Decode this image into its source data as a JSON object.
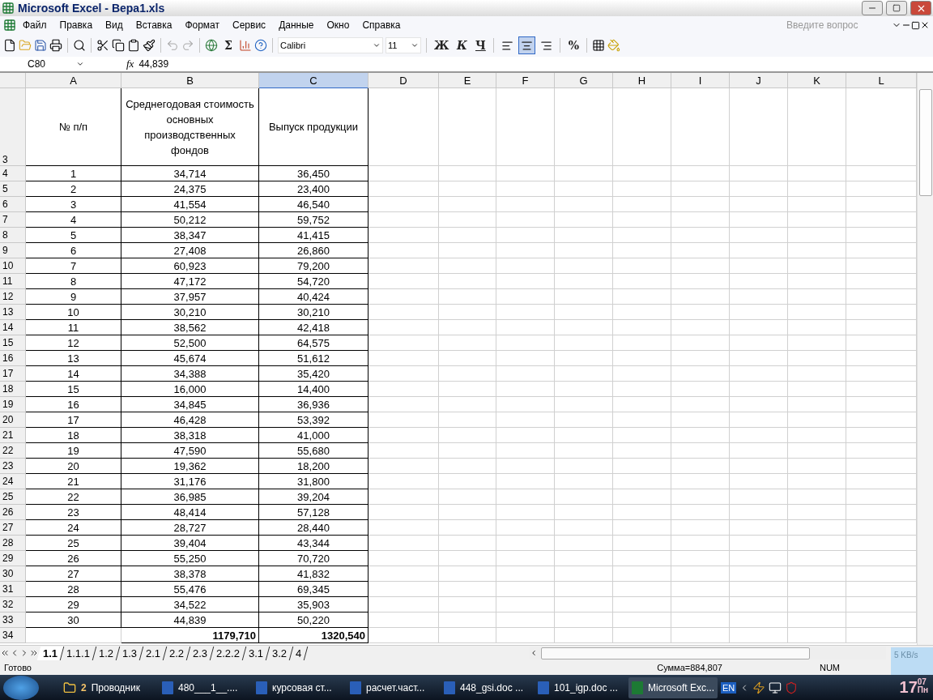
{
  "window": {
    "title": "Microsoft Excel - Вера1.xls"
  },
  "menu": {
    "items": [
      "Файл",
      "Правка",
      "Вид",
      "Вставка",
      "Формат",
      "Сервис",
      "Данные",
      "Окно",
      "Справка"
    ],
    "help_placeholder": "Введите вопрос"
  },
  "toolbar": {
    "sum": "Σ",
    "font": "Calibri",
    "size": "11",
    "format_buttons": [
      {
        "label": "Ж",
        "kind": "bold",
        "selected": false
      },
      {
        "label": "К",
        "kind": "italic",
        "selected": false
      },
      {
        "label": "Ч",
        "kind": "underline",
        "selected": false
      }
    ],
    "align_buttons": [
      {
        "kind": "left",
        "selected": false
      },
      {
        "kind": "center",
        "selected": true
      },
      {
        "kind": "right",
        "selected": false
      }
    ],
    "percent": "%"
  },
  "formula_bar": {
    "name_box": "C80",
    "fx": "fx",
    "value": "44,839"
  },
  "columns": [
    {
      "label": "A",
      "selected": false
    },
    {
      "label": "B",
      "selected": false
    },
    {
      "label": "C",
      "selected": true
    },
    {
      "label": "D",
      "selected": false
    },
    {
      "label": "E",
      "selected": false
    },
    {
      "label": "F",
      "selected": false
    },
    {
      "label": "G",
      "selected": false
    },
    {
      "label": "H",
      "selected": false
    },
    {
      "label": "I",
      "selected": false
    },
    {
      "label": "J",
      "selected": false
    },
    {
      "label": "K",
      "selected": false
    },
    {
      "label": "L",
      "selected": false
    }
  ],
  "header_row": {
    "number": "3",
    "cells": [
      "№ п/п",
      "Среднегодовая стоимость основных производственных фондов",
      "Выпуск продукции"
    ]
  },
  "rows": [
    {
      "number": "4",
      "cells": [
        "1",
        "34,714",
        "36,450"
      ]
    },
    {
      "number": "5",
      "cells": [
        "2",
        "24,375",
        "23,400"
      ]
    },
    {
      "number": "6",
      "cells": [
        "3",
        "41,554",
        "46,540"
      ]
    },
    {
      "number": "7",
      "cells": [
        "4",
        "50,212",
        "59,752"
      ]
    },
    {
      "number": "8",
      "cells": [
        "5",
        "38,347",
        "41,415"
      ]
    },
    {
      "number": "9",
      "cells": [
        "6",
        "27,408",
        "26,860"
      ]
    },
    {
      "number": "10",
      "cells": [
        "7",
        "60,923",
        "79,200"
      ]
    },
    {
      "number": "11",
      "cells": [
        "8",
        "47,172",
        "54,720"
      ]
    },
    {
      "number": "12",
      "cells": [
        "9",
        "37,957",
        "40,424"
      ]
    },
    {
      "number": "13",
      "cells": [
        "10",
        "30,210",
        "30,210"
      ]
    },
    {
      "number": "14",
      "cells": [
        "11",
        "38,562",
        "42,418"
      ]
    },
    {
      "number": "15",
      "cells": [
        "12",
        "52,500",
        "64,575"
      ]
    },
    {
      "number": "16",
      "cells": [
        "13",
        "45,674",
        "51,612"
      ]
    },
    {
      "number": "17",
      "cells": [
        "14",
        "34,388",
        "35,420"
      ]
    },
    {
      "number": "18",
      "cells": [
        "15",
        "16,000",
        "14,400"
      ]
    },
    {
      "number": "19",
      "cells": [
        "16",
        "34,845",
        "36,936"
      ]
    },
    {
      "number": "20",
      "cells": [
        "17",
        "46,428",
        "53,392"
      ]
    },
    {
      "number": "21",
      "cells": [
        "18",
        "38,318",
        "41,000"
      ]
    },
    {
      "number": "22",
      "cells": [
        "19",
        "47,590",
        "55,680"
      ]
    },
    {
      "number": "23",
      "cells": [
        "20",
        "19,362",
        "18,200"
      ]
    },
    {
      "number": "24",
      "cells": [
        "21",
        "31,176",
        "31,800"
      ]
    },
    {
      "number": "25",
      "cells": [
        "22",
        "36,985",
        "39,204"
      ]
    },
    {
      "number": "26",
      "cells": [
        "23",
        "48,414",
        "57,128"
      ]
    },
    {
      "number": "27",
      "cells": [
        "24",
        "28,727",
        "28,440"
      ]
    },
    {
      "number": "28",
      "cells": [
        "25",
        "39,404",
        "43,344"
      ]
    },
    {
      "number": "29",
      "cells": [
        "26",
        "55,250",
        "70,720"
      ]
    },
    {
      "number": "30",
      "cells": [
        "27",
        "38,378",
        "41,832"
      ]
    },
    {
      "number": "31",
      "cells": [
        "28",
        "55,476",
        "69,345"
      ]
    },
    {
      "number": "32",
      "cells": [
        "29",
        "34,522",
        "35,903"
      ]
    },
    {
      "number": "33",
      "cells": [
        "30",
        "44,839",
        "50,220"
      ]
    }
  ],
  "total_row": {
    "number": "34",
    "cells": [
      "",
      "1179,710",
      "1320,540"
    ]
  },
  "sheet_tabs": [
    {
      "label": "1.1",
      "selected": true
    },
    {
      "label": "1.1.1",
      "selected": false
    },
    {
      "label": "1.2",
      "selected": false
    },
    {
      "label": "1.3",
      "selected": false
    },
    {
      "label": "2.1",
      "selected": false
    },
    {
      "label": "2.2",
      "selected": false
    },
    {
      "label": "2.3",
      "selected": false
    },
    {
      "label": "2.2.2",
      "selected": false
    },
    {
      "label": "3.1",
      "selected": false
    },
    {
      "label": "3.2",
      "selected": false
    },
    {
      "label": "4",
      "selected": false
    }
  ],
  "net_speed": "5 KB/s",
  "status_bar": {
    "status": "Готово",
    "sum": "Сумма=884,807",
    "num": "NUM"
  },
  "taskbar": {
    "items": [
      {
        "label": "Проводник",
        "count": "2",
        "kind": "folder",
        "selected": false
      },
      {
        "label": "480___1__....",
        "kind": "word",
        "selected": false
      },
      {
        "label": "курсовая ст...",
        "kind": "word",
        "selected": false
      },
      {
        "label": "расчет.част...",
        "kind": "word",
        "selected": false
      },
      {
        "label": "448_gsi.doc ...",
        "kind": "word",
        "selected": false
      },
      {
        "label": "101_igp.doc ...",
        "kind": "word",
        "selected": false
      },
      {
        "label": "Microsoft Exc...",
        "kind": "excel",
        "selected": true
      }
    ],
    "language": "EN",
    "clock_hours": "17",
    "clock_minutes": "07",
    "clock_day": "Пн"
  }
}
